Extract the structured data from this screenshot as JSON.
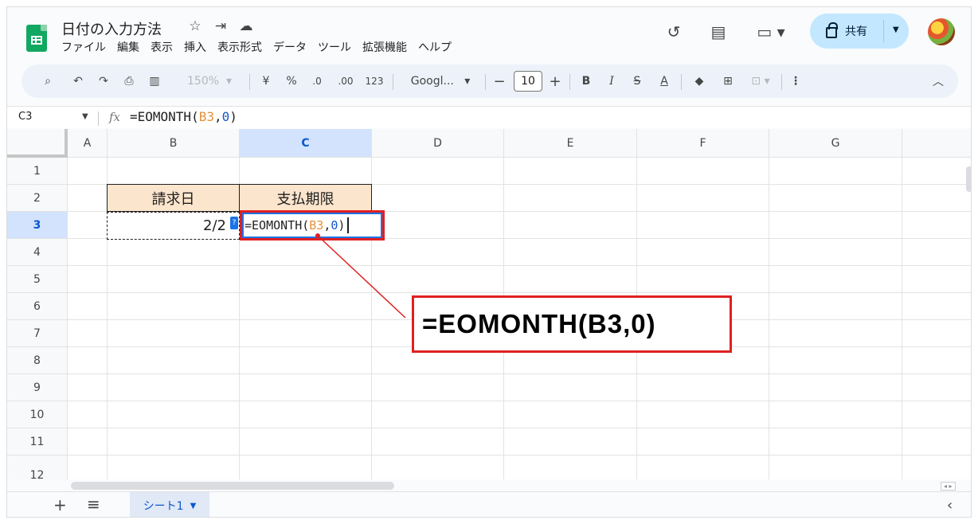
{
  "header": {
    "doc_title": "日付の入力方法",
    "title_icons": [
      "star-icon",
      "move-folder-icon",
      "cloud-status-icon"
    ],
    "menu": [
      "ファイル",
      "編集",
      "表示",
      "挿入",
      "表示形式",
      "データ",
      "ツール",
      "拡張機能",
      "ヘルプ"
    ],
    "share_label": "共有"
  },
  "toolbar": {
    "zoom": "150%",
    "currency": "¥",
    "percent": "%",
    "decimal_decrease": ".0",
    "decimal_increase": ".00",
    "number_format": "123",
    "font": "Googl...",
    "font_size": "10",
    "bold": "B",
    "italic": "I",
    "strike": "S",
    "text_color": "A"
  },
  "formula_bar": {
    "name_box": "C3",
    "formula_prefix": "=EOMONTH(",
    "formula_ref": "B3",
    "formula_sep": ",",
    "formula_arg": "0",
    "formula_suffix": ")"
  },
  "columns": [
    "A",
    "B",
    "C",
    "D",
    "E",
    "F",
    "G"
  ],
  "rows": [
    "1",
    "2",
    "3",
    "4",
    "5",
    "6",
    "7",
    "8",
    "9",
    "10",
    "11",
    "12"
  ],
  "cells": {
    "B2": "請求日",
    "C2": "支払期限",
    "B3": "2/2",
    "tooltip": "?"
  },
  "callout": {
    "text": "=EOMONTH(B3,0)"
  },
  "colors": {
    "accent_red": "#e02020",
    "header_fill": "#fce5cd",
    "selection_blue": "#d3e3fd",
    "ref_orange": "#e69138",
    "arg_blue": "#1155cc"
  },
  "sheets": {
    "active": "シート1"
  }
}
